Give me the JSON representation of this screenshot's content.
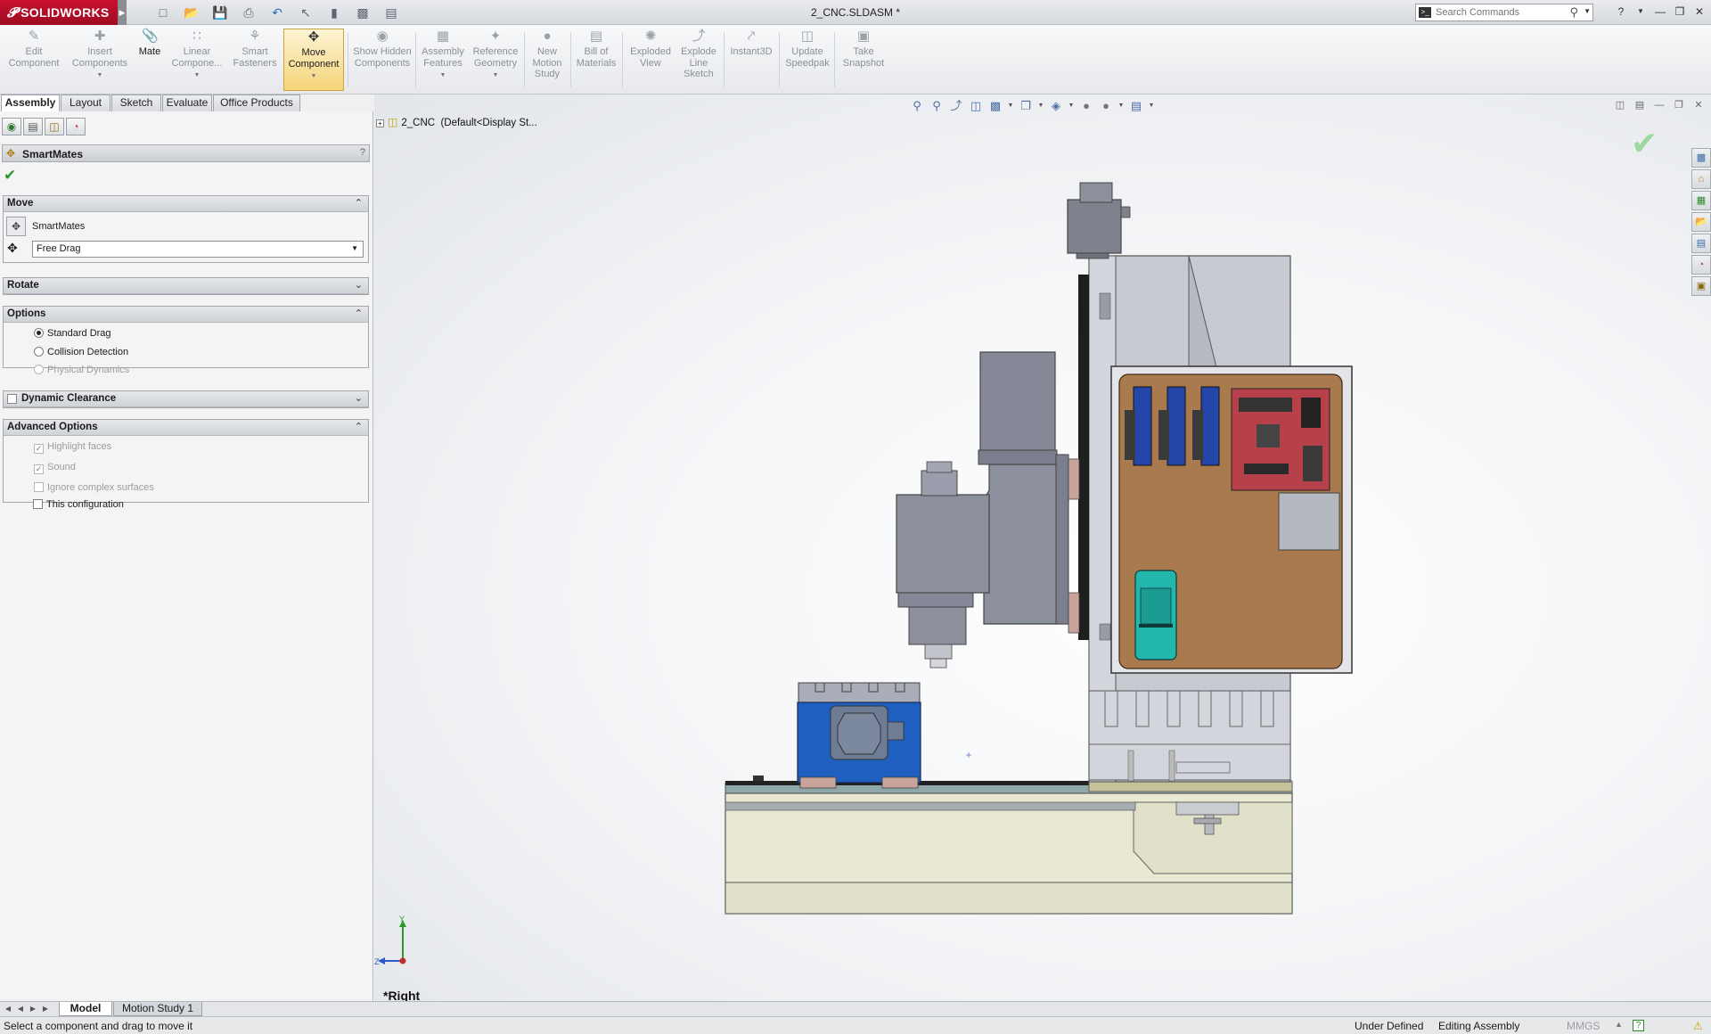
{
  "app": {
    "brand": "SOLIDWORKS",
    "document_title": "2_CNC.SLDASM *"
  },
  "search": {
    "placeholder": "Search Commands"
  },
  "ribbon": {
    "buttons": [
      {
        "label": "Edit Component"
      },
      {
        "label": "Insert Components"
      },
      {
        "label": "Mate"
      },
      {
        "label": "Linear Compone..."
      },
      {
        "label": "Smart Fasteners"
      },
      {
        "label": "Move Component"
      },
      {
        "label": "Show Hidden Components"
      },
      {
        "label": "Assembly Features"
      },
      {
        "label": "Reference Geometry"
      },
      {
        "label": "New Motion Study"
      },
      {
        "label": "Bill of Materials"
      },
      {
        "label": "Exploded View"
      },
      {
        "label": "Explode Line Sketch"
      },
      {
        "label": "Instant3D"
      },
      {
        "label": "Update Speedpak"
      },
      {
        "label": "Take Snapshot"
      }
    ]
  },
  "tabs": [
    "Assembly",
    "Layout",
    "Sketch",
    "Evaluate",
    "Office Products"
  ],
  "property_manager": {
    "title": "SmartMates",
    "help": "?",
    "move": {
      "header": "Move",
      "smartmates_label": "SmartMates",
      "drag_mode": "Free Drag"
    },
    "rotate": {
      "header": "Rotate"
    },
    "options": {
      "header": "Options",
      "standard_drag": "Standard Drag",
      "collision_detection": "Collision Detection",
      "physical_dynamics": "Physical Dynamics"
    },
    "dynamic_clearance": {
      "header": "Dynamic Clearance"
    },
    "advanced_options": {
      "header": "Advanced Options",
      "highlight_faces": "Highlight faces",
      "sound": "Sound",
      "ignore_complex": "Ignore complex surfaces",
      "this_configuration": "This configuration"
    }
  },
  "graphics": {
    "tree_root": "2_CNC",
    "tree_config": "(Default<Display St...",
    "view_label": "*Right",
    "triad": {
      "y": "Y",
      "z": "Z"
    }
  },
  "bottom_tabs": [
    "Model",
    "Motion Study 1"
  ],
  "status": {
    "message": "Select a component and drag to move it",
    "definition": "Under Defined",
    "mode": "Editing Assembly",
    "units": "MMGS",
    "help": "?"
  },
  "colors": {
    "brand_red": "#c8102e",
    "base_beige": "#e9e8d2",
    "panel_brown": "#a87a4e",
    "vise_blue": "#1f5fbf",
    "spindle_gray": "#858896",
    "driver_blue": "#2446a8",
    "board_red": "#b8404a",
    "psu_teal": "#23b6ad"
  }
}
